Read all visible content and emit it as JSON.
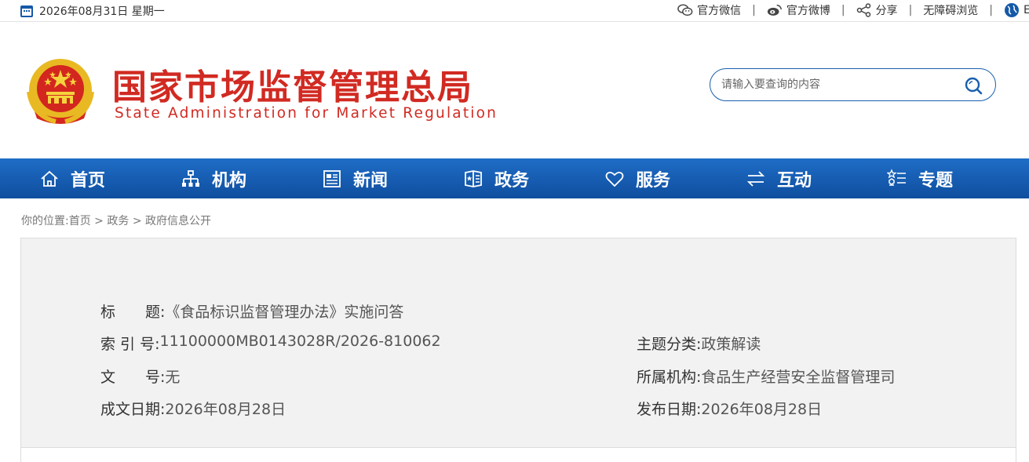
{
  "topbar": {
    "date": "2026年08月31日 星期一",
    "links": [
      {
        "label": "官方微信",
        "icon": "wechat-icon"
      },
      {
        "label": "官方微博",
        "icon": "weibo-icon"
      },
      {
        "label": "分享",
        "icon": "share-icon"
      },
      {
        "label": "无障碍浏览",
        "icon": ""
      },
      {
        "label": "E",
        "icon": "globe-icon"
      }
    ]
  },
  "header": {
    "title_cn": "国家市场监督管理总局",
    "title_en": "State Administration for Market Regulation",
    "search_placeholder": "请输入要查询的内容"
  },
  "nav": {
    "items": [
      {
        "label": "首页",
        "icon": "home-icon"
      },
      {
        "label": "机构",
        "icon": "org-chart-icon"
      },
      {
        "label": "新闻",
        "icon": "news-icon"
      },
      {
        "label": "政务",
        "icon": "government-icon"
      },
      {
        "label": "服务",
        "icon": "heart-icon"
      },
      {
        "label": "互动",
        "icon": "exchange-icon"
      },
      {
        "label": "专题",
        "icon": "topics-list-icon"
      }
    ]
  },
  "breadcrumb": {
    "prefix": "你的位置:",
    "items": [
      "首页",
      "政务",
      "政府信息公开"
    ],
    "separator": ">"
  },
  "info": {
    "title_label": "标　　题:",
    "title_value": "《食品标识监督管理办法》实施问答",
    "index_label": "索 引 号:",
    "index_value": "11100000MB0143028R/2026-810062",
    "category_label": "主题分类:",
    "category_value": "政策解读",
    "docno_label": "文　　号:",
    "docno_value": "无",
    "org_label": "所属机构:",
    "org_value": "食品生产经营安全监督管理司",
    "created_label": "成文日期:",
    "created_value": "2026年08月28日",
    "published_label": "发布日期:",
    "published_value": "2026年08月28日"
  },
  "colors": {
    "brand_red": "#d12a22",
    "nav_blue": "#1559a8",
    "panel_bg": "#f2f2f2"
  }
}
